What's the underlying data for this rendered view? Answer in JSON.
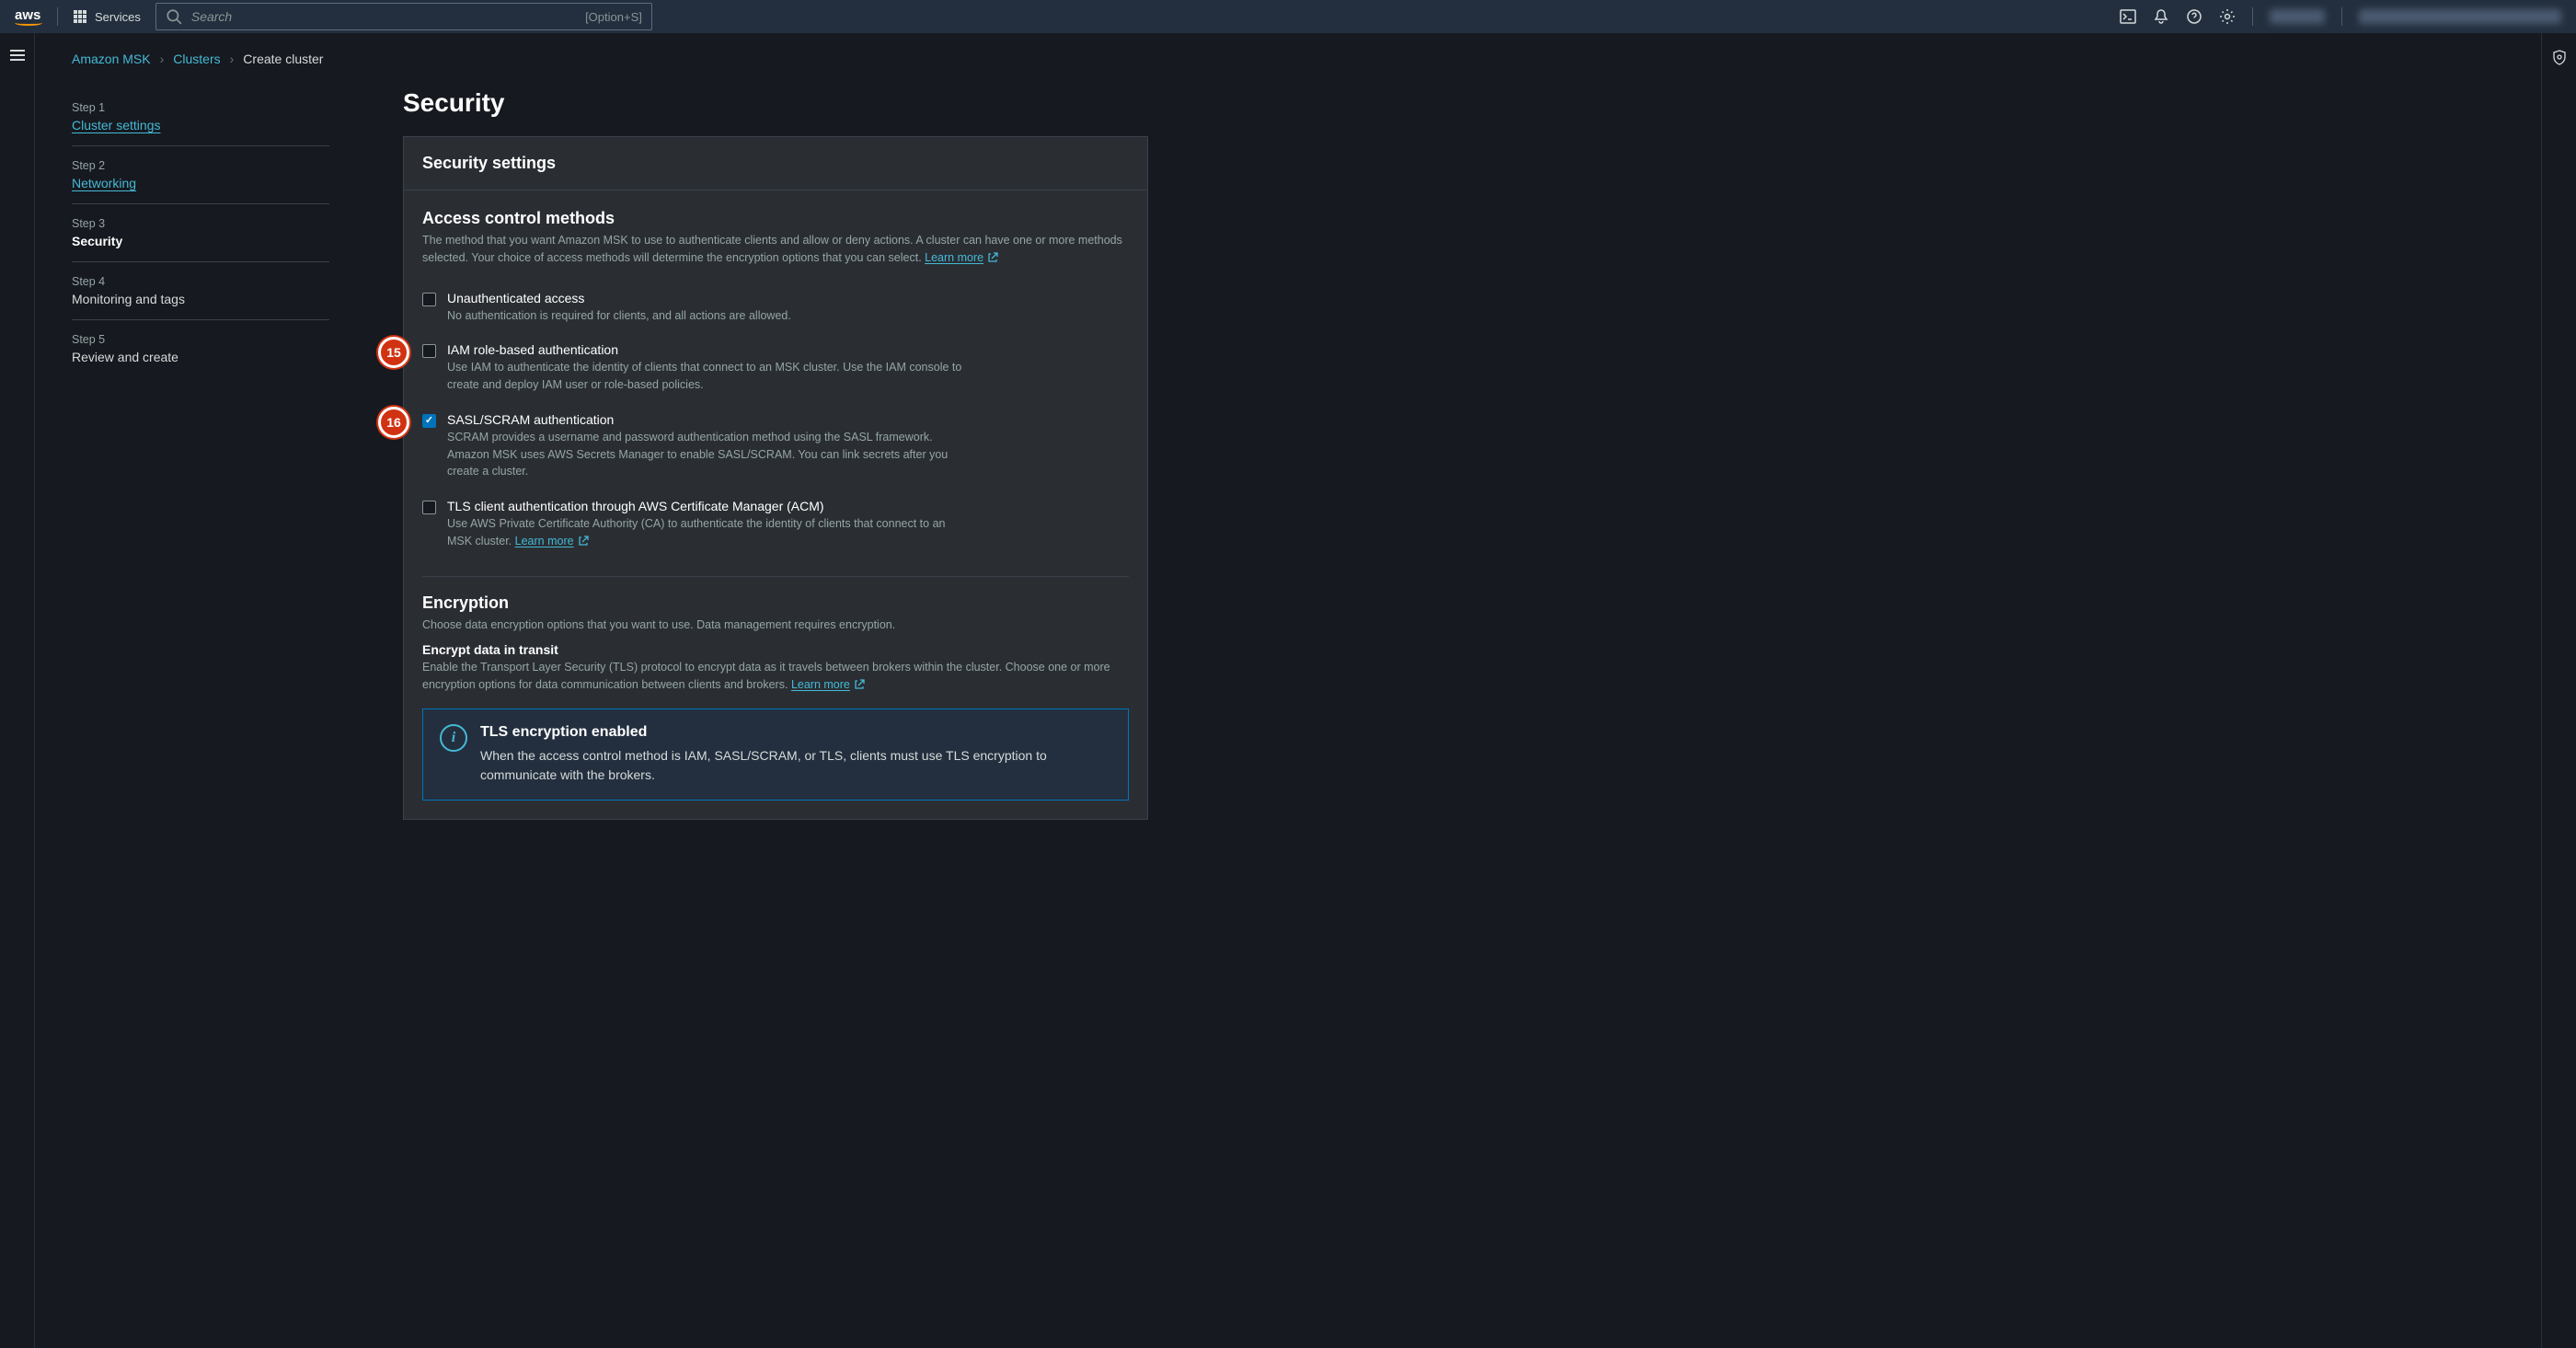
{
  "header": {
    "services_label": "Services",
    "search_placeholder": "Search",
    "search_hint": "[Option+S]"
  },
  "breadcrumb": {
    "items": [
      "Amazon MSK",
      "Clusters",
      "Create cluster"
    ]
  },
  "steps": [
    {
      "num": "Step 1",
      "title": "Cluster settings",
      "link": true
    },
    {
      "num": "Step 2",
      "title": "Networking",
      "link": true
    },
    {
      "num": "Step 3",
      "title": "Security",
      "current": true
    },
    {
      "num": "Step 4",
      "title": "Monitoring and tags"
    },
    {
      "num": "Step 5",
      "title": "Review and create"
    }
  ],
  "page": {
    "title": "Security",
    "panel_title": "Security settings"
  },
  "access": {
    "title": "Access control methods",
    "desc": "The method that you want Amazon MSK to use to authenticate clients and allow or deny actions. A cluster can have one or more methods selected. Your choice of access methods will determine the encryption options that you can select.",
    "learn_more": "Learn more",
    "items": [
      {
        "label": "Unauthenticated access",
        "desc": "No authentication is required for clients, and all actions are allowed.",
        "checked": false
      },
      {
        "label": "IAM role-based authentication",
        "desc": "Use IAM to authenticate the identity of clients that connect to an MSK cluster. Use the IAM console to create and deploy IAM user or role-based policies.",
        "checked": false,
        "callout": "15"
      },
      {
        "label": "SASL/SCRAM authentication",
        "desc": "SCRAM provides a username and password authentication method using the SASL framework. Amazon MSK uses AWS Secrets Manager to enable SASL/SCRAM. You can link secrets after you create a cluster.",
        "checked": true,
        "callout": "16"
      },
      {
        "label": "TLS client authentication through AWS Certificate Manager (ACM)",
        "desc": "Use AWS Private Certificate Authority (CA) to authenticate the identity of clients that connect to an MSK cluster.",
        "checked": false,
        "learn_more": "Learn more"
      }
    ]
  },
  "encryption": {
    "title": "Encryption",
    "desc": "Choose data encryption options that you want to use. Data management requires encryption.",
    "sub_title": "Encrypt data in transit",
    "sub_desc": "Enable the Transport Layer Security (TLS) protocol to encrypt data as it travels between brokers within the cluster. Choose one or more encryption options for data communication between clients and brokers.",
    "learn_more": "Learn more",
    "info": {
      "title": "TLS encryption enabled",
      "desc": "When the access control method is IAM, SASL/SCRAM, or TLS, clients must use TLS encryption to communicate with the brokers."
    }
  }
}
